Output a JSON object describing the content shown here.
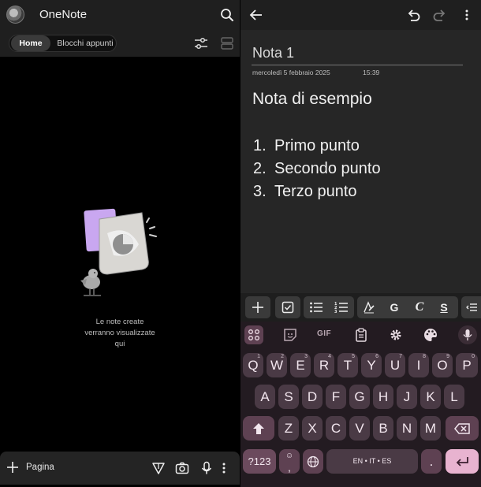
{
  "left": {
    "app_title": "OneNote",
    "tabs": [
      {
        "label": "Home",
        "active": true
      },
      {
        "label": "Blocchi appunti",
        "active": false
      }
    ],
    "empty_message": [
      "Le note create",
      "verranno visualizzate",
      "qui"
    ],
    "bottom_bar": {
      "new_page_label": "Pagina"
    }
  },
  "note": {
    "title": "Nota 1",
    "date": "mercoledì 5 febbraio 2025",
    "time": "15:39",
    "heading": "Nota di esempio",
    "list": [
      {
        "num": "1.",
        "text": "Primo punto"
      },
      {
        "num": "2.",
        "text": "Secondo punto"
      },
      {
        "num": "3.",
        "text": "Terzo punto"
      }
    ]
  },
  "format_bar": {
    "bold_label": "G",
    "italic_label": "C",
    "strike_label": "S"
  },
  "keyboard": {
    "gif_label": "GIF",
    "row1": [
      {
        "k": "Q",
        "h": "1"
      },
      {
        "k": "W",
        "h": "2"
      },
      {
        "k": "E",
        "h": "3"
      },
      {
        "k": "R",
        "h": "4"
      },
      {
        "k": "T",
        "h": "5"
      },
      {
        "k": "Y",
        "h": "6"
      },
      {
        "k": "U",
        "h": "7"
      },
      {
        "k": "I",
        "h": "8"
      },
      {
        "k": "O",
        "h": "9"
      },
      {
        "k": "P",
        "h": "0"
      }
    ],
    "row2": [
      "A",
      "S",
      "D",
      "F",
      "G",
      "H",
      "J",
      "K",
      "L"
    ],
    "row3": [
      "Z",
      "X",
      "C",
      "V",
      "B",
      "N",
      "M"
    ],
    "symbols_label": "?123",
    "emoji_hint": "☺",
    "comma_label": ",",
    "space_label": "EN • IT • ES",
    "period_label": "."
  },
  "colors": {
    "enter_key": "#e8b3d0",
    "keyboard_bg": "#231b21",
    "key_bg": "#4a3a45",
    "illustration_purple": "#c9a7f0"
  }
}
